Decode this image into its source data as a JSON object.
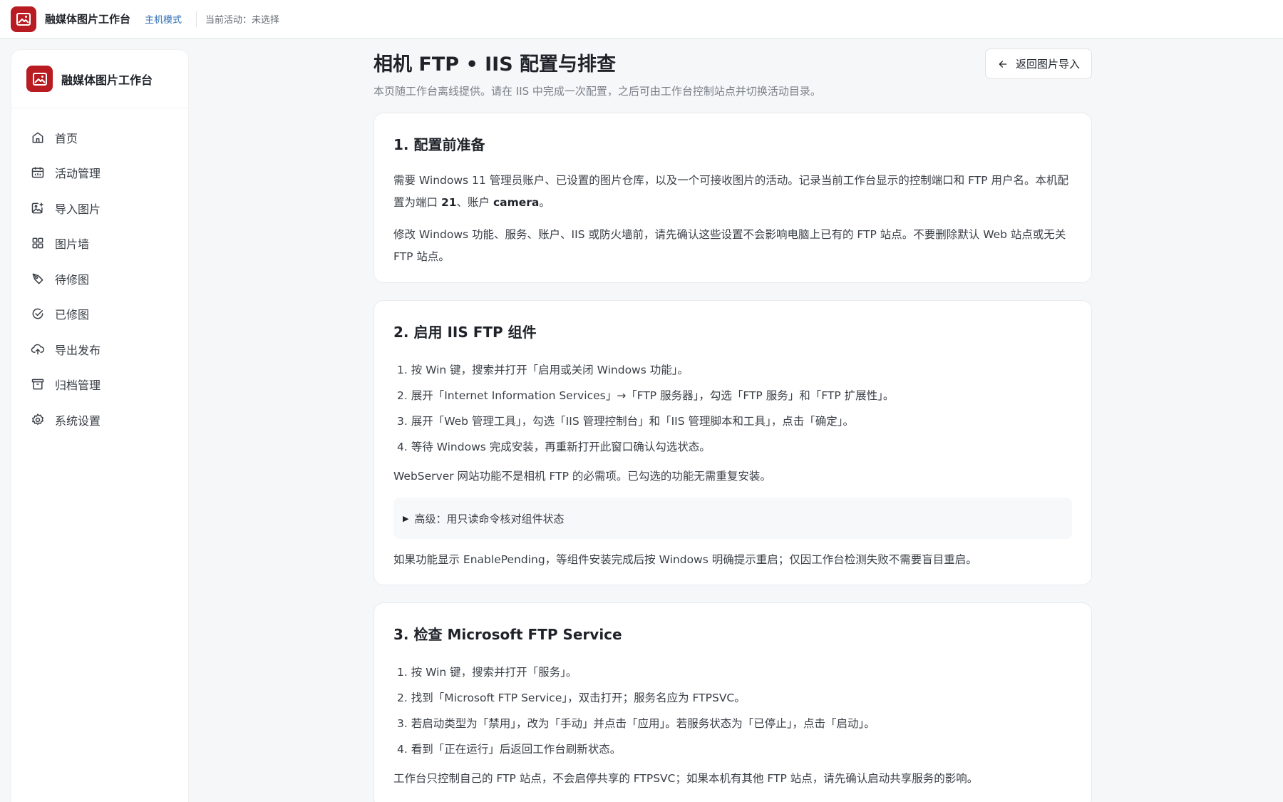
{
  "topbar": {
    "title": "融媒体图片工作台",
    "mode": "主机模式",
    "activity": "当前活动：未选择"
  },
  "sidebar": {
    "title": "融媒体图片工作台",
    "items": [
      {
        "label": "首页",
        "icon": "home-icon"
      },
      {
        "label": "活动管理",
        "icon": "calendar-icon"
      },
      {
        "label": "导入图片",
        "icon": "image-add-icon"
      },
      {
        "label": "图片墙",
        "icon": "grid-icon"
      },
      {
        "label": "待修图",
        "icon": "brush-icon"
      },
      {
        "label": "已修图",
        "icon": "check-circle-icon"
      },
      {
        "label": "导出发布",
        "icon": "cloud-upload-icon"
      },
      {
        "label": "归档管理",
        "icon": "archive-icon"
      },
      {
        "label": "系统设置",
        "icon": "gear-icon"
      }
    ]
  },
  "page": {
    "title": "相机 FTP • IIS 配置与排查",
    "subtitle": "本页随工作台离线提供。请在 IIS 中完成一次配置，之后可由工作台控制站点并切换活动目录。",
    "back_label": "返回图片导入"
  },
  "sections": {
    "s1": {
      "title": "1. 配置前准备",
      "p1_a": "需要 Windows 11 管理员账户、已设置的图片仓库，以及一个可接收图片的活动。记录当前工作台显示的控制端口和 FTP 用户名。本机配置为端口 ",
      "p1_port": "21",
      "p1_b": "、账户 ",
      "p1_user": "camera",
      "p1_c": "。",
      "p2": "修改 Windows 功能、服务、账户、IIS 或防火墙前，请先确认这些设置不会影响电脑上已有的 FTP 站点。不要删除默认 Web 站点或无关 FTP 站点。"
    },
    "s2": {
      "title": "2. 启用 IIS FTP 组件",
      "steps": [
        "1. 按 Win 键，搜索并打开「启用或关闭 Windows 功能」。",
        "2. 展开「Internet Information Services」→「FTP 服务器」，勾选「FTP 服务」和「FTP 扩展性」。",
        "3. 展开「Web 管理工具」，勾选「IIS 管理控制台」和「IIS 管理脚本和工具」，点击「确定」。",
        "4. 等待 Windows 完成安装，再重新打开此窗口确认勾选状态。"
      ],
      "note": "WebServer 网站功能不是相机 FTP 的必需项。已勾选的功能无需重复安装。",
      "details_label": "高级：用只读命令核对组件状态",
      "footer": "如果功能显示 EnablePending，等组件安装完成后按 Windows 明确提示重启；仅因工作台检测失败不需要盲目重启。"
    },
    "s3": {
      "title": "3. 检查 Microsoft FTP Service",
      "steps": [
        "1. 按 Win 键，搜索并打开「服务」。",
        "2. 找到「Microsoft FTP Service」，双击打开；服务名应为 FTPSVC。",
        "3. 若启动类型为「禁用」，改为「手动」并点击「应用」。若服务状态为「已停止」，点击「启动」。",
        "4. 看到「正在运行」后返回工作台刷新状态。"
      ],
      "note": "工作台只控制自己的 FTP 站点，不会启停共享的 FTPSVC；如果本机有其他 FTP 站点，请先确认启动共享服务的影响。"
    }
  },
  "colors": {
    "brand": "#b81c22",
    "mode": "#2f6fb3"
  }
}
